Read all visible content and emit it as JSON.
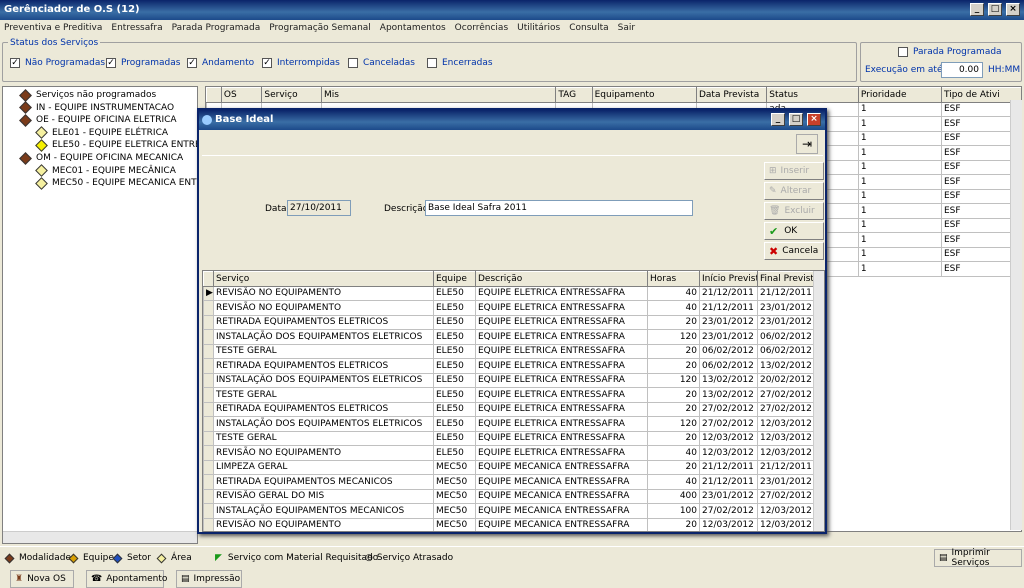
{
  "window": {
    "title": "Gerênciador de O.S (12)"
  },
  "menu": [
    "Preventiva e Preditiva",
    "Entressafra",
    "Parada Programada",
    "Programação Semanal",
    "Apontamentos",
    "Ocorrências",
    "Utilitários",
    "Consulta",
    "Sair"
  ],
  "status": {
    "label": "Status dos Serviços",
    "items": [
      {
        "label": "Não Programadas",
        "checked": true
      },
      {
        "label": "Programadas",
        "checked": true
      },
      {
        "label": "Andamento",
        "checked": true
      },
      {
        "label": "Interrompidas",
        "checked": true
      },
      {
        "label": "Canceladas",
        "checked": false
      },
      {
        "label": "Encerradas",
        "checked": false
      }
    ]
  },
  "parada": {
    "label": "Parada Programada",
    "exec_label": "Execução em até:",
    "exec_value": "0.00",
    "unit": "HH:MM"
  },
  "tree": [
    {
      "label": "Serviços não programados",
      "level": 0,
      "color": "#7a3b1a"
    },
    {
      "label": "IN - EQUIPE INSTRUMENTACAO",
      "level": 0,
      "color": "#7a3b1a"
    },
    {
      "label": "OE - EQUIPE OFICINA ELETRICA",
      "level": 0,
      "color": "#7a3b1a"
    },
    {
      "label": "ELE01 - EQUIPE ELÉTRICA",
      "level": 1,
      "color": "#f5f0a0"
    },
    {
      "label": "ELE50 - EQUIPE ELETRICA ENTRES",
      "level": 1,
      "color": "#f5f000"
    },
    {
      "label": "OM - EQUIPE OFICINA MECANICA",
      "level": 0,
      "color": "#7a3b1a"
    },
    {
      "label": "MEC01 - EQUIPE MECÂNICA",
      "level": 1,
      "color": "#f5f0a0"
    },
    {
      "label": "MEC50 - EQUIPE MECANICA ENTRE",
      "level": 1,
      "color": "#f5f0a0"
    }
  ],
  "bg_grid": {
    "headers": [
      "",
      "OS",
      "Serviço",
      "Mis",
      "TAG",
      "Equipamento",
      "Data Prevista",
      "Status",
      "Prioridade",
      "Tipo de Ativi"
    ],
    "rows": [
      [
        "ada",
        "1",
        "ESF"
      ],
      [
        "ada",
        "1",
        "ESF"
      ],
      [
        "ada",
        "1",
        "ESF"
      ],
      [
        "ada",
        "1",
        "ESF"
      ],
      [
        "ada",
        "1",
        "ESF"
      ],
      [
        "ada",
        "1",
        "ESF"
      ],
      [
        "ada",
        "1",
        "ESF"
      ],
      [
        "ada",
        "1",
        "ESF"
      ],
      [
        "ada",
        "1",
        "ESF"
      ],
      [
        "ada",
        "1",
        "ESF"
      ],
      [
        "ada",
        "1",
        "ESF"
      ],
      [
        "ada",
        "1",
        "ESF"
      ]
    ]
  },
  "legend": {
    "modalidade": "Modalidade",
    "equipe": "Equipe",
    "setor": "Setor",
    "area": "Área",
    "material": "Serviço com Material Requisitado",
    "atrasado": "Serviço Atrasado",
    "imprimir": "Imprimir Serviços"
  },
  "bottom": {
    "nova": "Nova OS",
    "apontamento": "Apontamento",
    "impressao": "Impressão"
  },
  "dialog": {
    "title": "Base Ideal",
    "data_label": "Data",
    "data_value": "27/10/2011",
    "desc_label": "Descrição",
    "desc_value": "Base Ideal Safra 2011",
    "buttons": {
      "inserir": "Inserir",
      "alterar": "Alterar",
      "excluir": "Excluir",
      "ok": "OK",
      "cancela": "Cancela"
    },
    "headers": [
      "Serviço",
      "Equipe",
      "Descrição",
      "Horas",
      "Início Previsto",
      "Final Previsto"
    ],
    "rows": [
      [
        "REVISÃO NO EQUIPAMENTO",
        "ELE50",
        "EQUIPE ELETRICA ENTRESSAFRA",
        "40",
        "21/12/2011",
        "21/12/2011"
      ],
      [
        "REVISÃO NO EQUIPAMENTO",
        "ELE50",
        "EQUIPE ELETRICA ENTRESSAFRA",
        "40",
        "21/12/2011",
        "23/01/2012"
      ],
      [
        "RETIRADA EQUIPAMENTOS ELETRICOS",
        "ELE50",
        "EQUIPE ELETRICA ENTRESSAFRA",
        "20",
        "23/01/2012",
        "23/01/2012"
      ],
      [
        "INSTALAÇÃO DOS EQUIPAMENTOS ELETRICOS",
        "ELE50",
        "EQUIPE ELETRICA ENTRESSAFRA",
        "120",
        "23/01/2012",
        "06/02/2012"
      ],
      [
        "TESTE GERAL",
        "ELE50",
        "EQUIPE ELETRICA ENTRESSAFRA",
        "20",
        "06/02/2012",
        "06/02/2012"
      ],
      [
        "RETIRADA EQUIPAMENTOS ELETRICOS",
        "ELE50",
        "EQUIPE ELETRICA ENTRESSAFRA",
        "20",
        "06/02/2012",
        "13/02/2012"
      ],
      [
        "INSTALAÇÃO DOS EQUIPAMENTOS ELETRICOS",
        "ELE50",
        "EQUIPE ELETRICA ENTRESSAFRA",
        "120",
        "13/02/2012",
        "20/02/2012"
      ],
      [
        "TESTE GERAL",
        "ELE50",
        "EQUIPE ELETRICA ENTRESSAFRA",
        "20",
        "13/02/2012",
        "27/02/2012"
      ],
      [
        "RETIRADA EQUIPAMENTOS ELETRICOS",
        "ELE50",
        "EQUIPE ELETRICA ENTRESSAFRA",
        "20",
        "27/02/2012",
        "27/02/2012"
      ],
      [
        "INSTALAÇÃO DOS EQUIPAMENTOS ELETRICOS",
        "ELE50",
        "EQUIPE ELETRICA ENTRESSAFRA",
        "120",
        "27/02/2012",
        "12/03/2012"
      ],
      [
        "TESTE GERAL",
        "ELE50",
        "EQUIPE ELETRICA ENTRESSAFRA",
        "20",
        "12/03/2012",
        "12/03/2012"
      ],
      [
        "REVISÃO NO EQUIPAMENTO",
        "ELE50",
        "EQUIPE ELETRICA ENTRESSAFRA",
        "40",
        "12/03/2012",
        "12/03/2012"
      ],
      [
        "LIMPEZA GERAL",
        "MEC50",
        "EQUIPE MECANICA ENTRESSAFRA",
        "20",
        "21/12/2011",
        "21/12/2011"
      ],
      [
        "RETIRADA EQUIPAMENTOS MECANICOS",
        "MEC50",
        "EQUIPE MECANICA ENTRESSAFRA",
        "40",
        "21/12/2011",
        "23/01/2012"
      ],
      [
        "REVISÃO GERAL DO MIS",
        "MEC50",
        "EQUIPE MECANICA ENTRESSAFRA",
        "400",
        "23/01/2012",
        "27/02/2012"
      ],
      [
        "INSTALAÇÃO EQUIPAMENTOS MECANICOS",
        "MEC50",
        "EQUIPE MECANICA ENTRESSAFRA",
        "100",
        "27/02/2012",
        "12/03/2012"
      ],
      [
        "REVISÃO NO EQUIPAMENTO",
        "MEC50",
        "EQUIPE MECANICA ENTRESSAFRA",
        "20",
        "12/03/2012",
        "12/03/2012"
      ]
    ]
  }
}
